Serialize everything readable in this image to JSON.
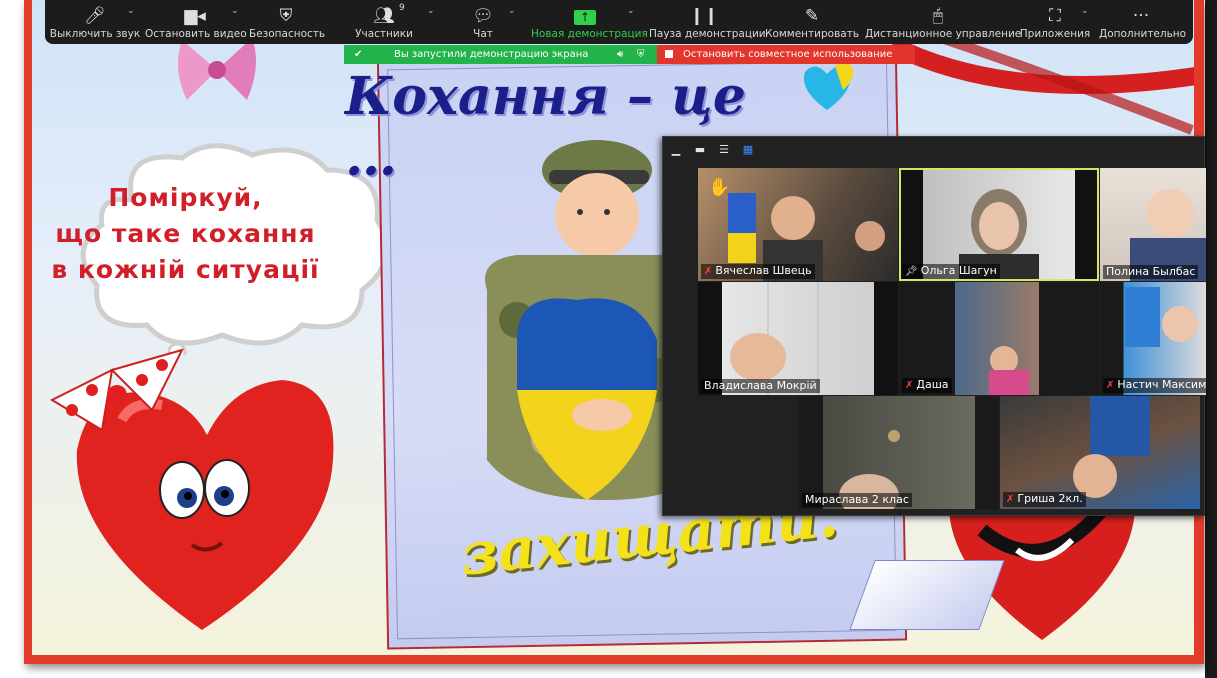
{
  "toolbar": {
    "mute_label": "Выключить звук",
    "video_label": "Остановить видео",
    "security_label": "Безопасность",
    "participants_label": "Участники",
    "participants_count": "9",
    "chat_label": "Чат",
    "new_share_label": "Новая демонстрация",
    "pause_share_label": "Пауза демонстрации",
    "annotate_label": "Комментировать",
    "remote_control_label": "Дистанционное управление",
    "apps_label": "Приложения",
    "more_label": "Дополнительно"
  },
  "share_banner": {
    "status_text": "Вы запустили демонстрацию экрана",
    "stop_label": "Остановить совместное использование"
  },
  "slide": {
    "title": "Кохання – це …",
    "bubble_line1": "Поміркуй,",
    "bubble_line2": "що таке кохання",
    "bubble_line3": "в кожній ситуації",
    "bottom_word": "захищати."
  },
  "participants": [
    {
      "name": "Вячеслав Швець",
      "muted": true
    },
    {
      "name": "Ольга Шагун",
      "muted": false
    },
    {
      "name": "Полина Былбас",
      "muted": false
    },
    {
      "name": "Владислава Мокрій",
      "muted": false
    },
    {
      "name": "Даша",
      "muted": true
    },
    {
      "name": "Настич Максим",
      "muted": true
    },
    {
      "name": "Мирaслава 2 клас",
      "muted": false
    },
    {
      "name": "Гриша 2кл.",
      "muted": true
    }
  ],
  "colors": {
    "toolbar_bg": "#1c1c1c",
    "share_green": "#22b34a",
    "stop_red": "#e2362d",
    "active_speaker": "#d6e36d"
  }
}
